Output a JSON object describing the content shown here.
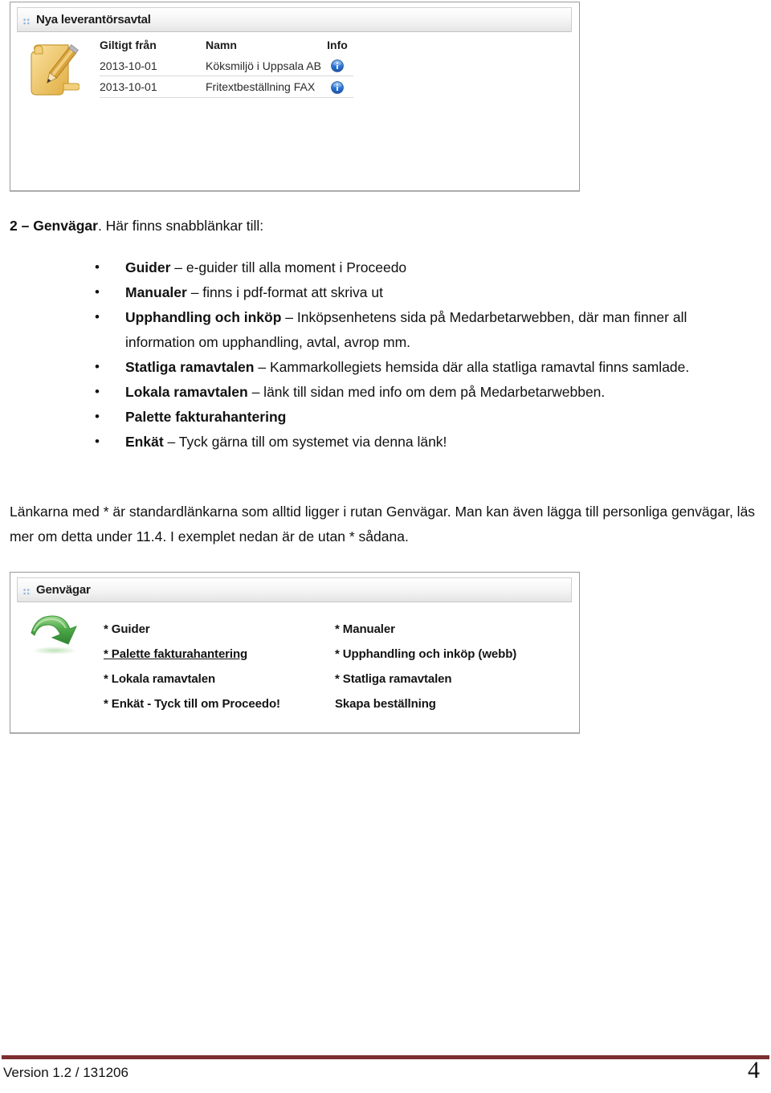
{
  "panel_agreements": {
    "title": "Nya leverantörsavtal",
    "grip_icon": "grip-dots-icon",
    "left_icon": "note-pencil-icon",
    "columns": [
      "Giltigt från",
      "Namn",
      "Info"
    ],
    "rows": [
      {
        "valid_from": "2013-10-01",
        "name": "Köksmiljö i Uppsala AB",
        "info_icon": "info-circle-icon"
      },
      {
        "valid_from": "2013-10-01",
        "name": "Fritextbeställning FAX",
        "info_icon": "info-circle-icon"
      }
    ]
  },
  "body": {
    "intro_number": "2 – ",
    "intro_bold": "Genvägar",
    "intro_rest": ". Här finns snabblänkar till:",
    "bullets": [
      {
        "bold": "Guider",
        "rest": " – e-guider till alla moment i Proceedo"
      },
      {
        "bold": "Manualer",
        "rest": " – finns i pdf-format att skriva ut"
      },
      {
        "bold": "Upphandling och inköp",
        "rest": " – Inköpsenhetens sida på Medarbetarwebben, där man finner all information om upphandling, avtal, avrop mm."
      },
      {
        "bold": "Statliga ramavtalen",
        "rest": " – Kammarkollegiets hemsida där alla statliga ramavtal finns samlade."
      },
      {
        "bold": "Lokala ramavtalen",
        "rest": " – länk till sidan med info om dem på Medarbetarwebben."
      },
      {
        "bold": "Palette fakturahantering",
        "rest": ""
      },
      {
        "bold": "Enkät",
        "rest": " – Tyck gärna till om systemet via denna länk!"
      }
    ],
    "note": "Länkarna med * är standardlänkarna som alltid ligger i rutan Genvägar. Man kan även lägga till personliga genvägar, läs mer om detta under 11.4. I exemplet nedan är de utan * sådana."
  },
  "panel_shortcuts": {
    "title": "Genvägar",
    "grip_icon": "grip-dots-icon",
    "left_icon": "green-curved-arrow-icon",
    "links": [
      {
        "label": "* Guider",
        "hovered": false
      },
      {
        "label": "* Manualer",
        "hovered": false
      },
      {
        "label": "* Palette fakturahantering",
        "hovered": true
      },
      {
        "label": "* Upphandling och inköp (webb)",
        "hovered": false
      },
      {
        "label": "* Lokala ramavtalen",
        "hovered": false
      },
      {
        "label": "* Statliga ramavtalen",
        "hovered": false
      },
      {
        "label": "* Enkät - Tyck till om Proceedo!",
        "hovered": false
      },
      {
        "label": "Skapa beställning",
        "hovered": false
      }
    ]
  },
  "footer": {
    "version": "Version 1.2 / 131206",
    "page_number": "4",
    "rule_color": "#7b2f2f"
  }
}
